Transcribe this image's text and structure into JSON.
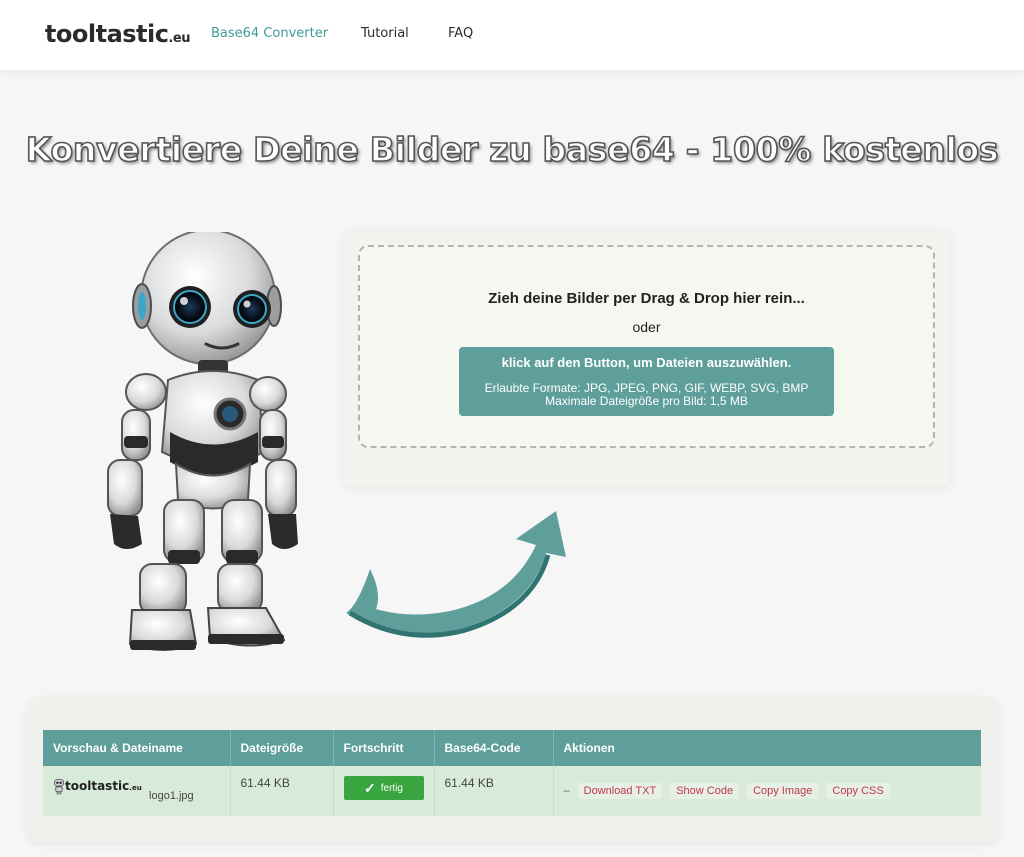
{
  "header": {
    "logo_main": "tooltastic",
    "logo_tld": ".eu",
    "nav": [
      {
        "label": "Base64 Converter",
        "active": true
      },
      {
        "label": "Tutorial",
        "active": false
      },
      {
        "label": "FAQ",
        "active": false
      }
    ]
  },
  "hero": {
    "title": "Konvertiere Deine Bilder zu base64 - 100% kostenlos"
  },
  "upload": {
    "drop_title": "Zieh deine Bilder per Drag & Drop hier rein...",
    "or": "oder",
    "button_label": "klick auf den Button, um Dateien auszuwählen.",
    "formats": "Erlaubte Formate: JPG, JPEG, PNG, GIF, WEBP, SVG, BMP",
    "max_size": "Maximale Dateigröße pro Bild: 1,5 MB"
  },
  "results": {
    "columns": [
      "Vorschau & Dateiname",
      "Dateigröße",
      "Fortschritt",
      "Base64-Code",
      "Aktionen"
    ],
    "rows": [
      {
        "thumb_main": "tooltastic",
        "thumb_tld": ".eu",
        "filename": "logo1.jpg",
        "size": "61.44 KB",
        "progress": "fertig",
        "base64_size": "61.44 KB",
        "dash": "–",
        "actions": [
          "Download TXT",
          "Show Code",
          "Copy Image",
          "Copy CSS"
        ]
      }
    ]
  },
  "colors": {
    "accent": "#5f9f9b",
    "nav_active": "#3f9b95",
    "success": "#38a53f",
    "action_link": "#c0394b"
  }
}
